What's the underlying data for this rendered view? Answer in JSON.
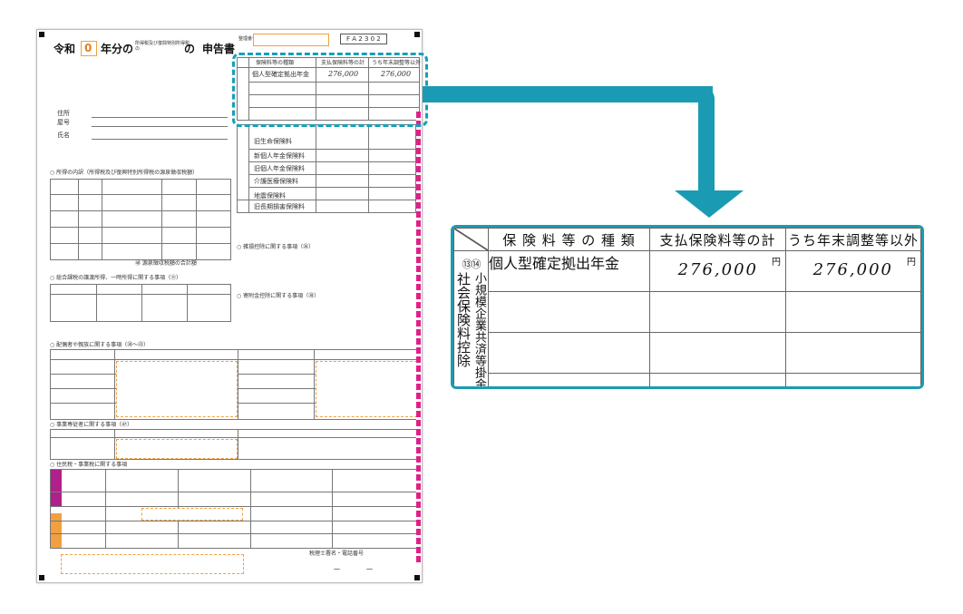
{
  "form": {
    "reiwa": "令和",
    "year": "0",
    "title_a": "年分の",
    "title_small": "所得税及び復興特別所得税の",
    "title_b": "の",
    "shinkokusho": "申告書",
    "seiri_label": "整理番号",
    "form_code": "F A 2 3 0 2",
    "address_label": "住所",
    "yago_label": "屋号",
    "name_label": "氏名",
    "thumb_headers": [
      "保険料等の種類",
      "支払保険料等の計",
      "うち年末調整等以外"
    ],
    "thumb_row": "個人型確定拠出年金",
    "thumb_amount_1": "276,000",
    "thumb_amount_2": "276,000",
    "sections": [
      "○ 所得の内訳（所得税及び復興特別所得税の源泉徴収税額）",
      "○ 総合課税の譲渡所得、一時所得に関する事項（⑪）",
      "○ 配偶者や親族に関する事項（⑳～㉓）",
      "○ 事業専従者に関する事項（㊼）",
      "○ 住民税・事業税に関する事項"
    ],
    "insurance_rows": [
      "旧生命保険料",
      "新個人年金保険料",
      "旧個人年金保険料",
      "介護医療保険料",
      "地震保険料",
      "旧長期損害保険料"
    ],
    "kifukin": "○ 寄附金控除に関する事項（㉘）",
    "shogai": "○ 雑損控除に関する事項（㉖）",
    "gensen_total": "㊽ 源泉徴収税額の合計額",
    "tax_accountant": "税理士署名・電話番号",
    "phone_dashes": "－　　　－"
  },
  "detail": {
    "headers": [
      "保 険 料 等 の 種 類",
      "支払保険料等の計",
      "うち年末調整等以外"
    ],
    "category_circles": "⑬⑭",
    "category_main": "社会保険料控除",
    "category_sub": "小規模企業共済等掛金控除",
    "row_label": "個人型確定拠出年金",
    "amount_total": "276,000",
    "amount_other": "276,000",
    "yen": "円"
  },
  "colors": {
    "accent": "#1a9bb3",
    "orange_field": "#f0a040",
    "magenta_strip": "#e0208a"
  }
}
